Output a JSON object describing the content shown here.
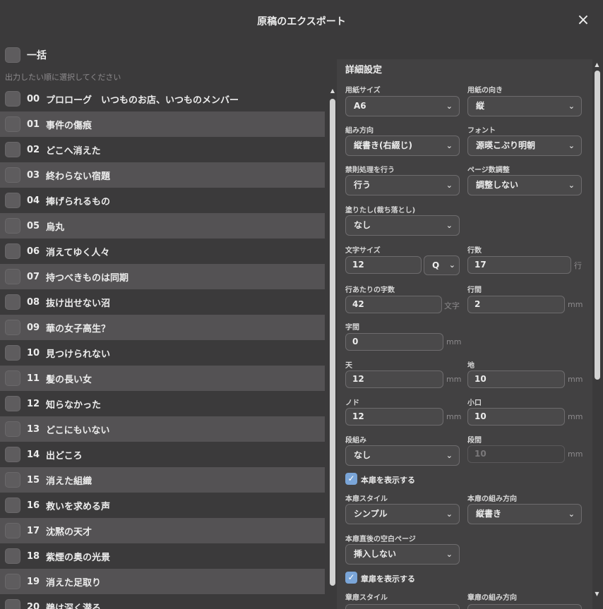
{
  "dialog": {
    "title": "原稿のエクスポート",
    "close_icon": "×"
  },
  "select_all": {
    "label": "一括"
  },
  "hint": "出力したい順に選択してください",
  "chapters": [
    {
      "num": "00",
      "title": "プロローグ　いつものお店、いつものメンバー"
    },
    {
      "num": "01",
      "title": "事件の傷痕"
    },
    {
      "num": "02",
      "title": "どこへ消えた"
    },
    {
      "num": "03",
      "title": "終わらない宿題"
    },
    {
      "num": "04",
      "title": "捧げられるもの"
    },
    {
      "num": "05",
      "title": "烏丸"
    },
    {
      "num": "06",
      "title": "消えてゆく人々"
    },
    {
      "num": "07",
      "title": "持つべきものは同期"
    },
    {
      "num": "08",
      "title": "抜け出せない沼"
    },
    {
      "num": "09",
      "title": "華の女子高生？"
    },
    {
      "num": "10",
      "title": "見つけられない"
    },
    {
      "num": "11",
      "title": "髪の長い女"
    },
    {
      "num": "12",
      "title": "知らなかった"
    },
    {
      "num": "13",
      "title": "どこにもいない"
    },
    {
      "num": "14",
      "title": "出どころ"
    },
    {
      "num": "15",
      "title": "消えた組織"
    },
    {
      "num": "16",
      "title": "救いを求める声"
    },
    {
      "num": "17",
      "title": "沈黙の天才"
    },
    {
      "num": "18",
      "title": "紫煙の奥の光景"
    },
    {
      "num": "19",
      "title": "消えた足取り"
    },
    {
      "num": "20",
      "title": "鵜は深く潜る"
    }
  ],
  "settings": {
    "title": "詳細設定",
    "paper_size": {
      "label": "用紙サイズ",
      "value": "A6"
    },
    "orientation": {
      "label": "用紙の向き",
      "value": "縦"
    },
    "writing_direction": {
      "label": "組み方向",
      "value": "縦書き(右綴じ)"
    },
    "font": {
      "label": "フォント",
      "value": "源暎こぶり明朝"
    },
    "kinsoku": {
      "label": "禁則処理を行う",
      "value": "行う"
    },
    "page_adjust": {
      "label": "ページ数調整",
      "value": "調整しない"
    },
    "bleed": {
      "label": "塗りたし(裁ち落とし)",
      "value": "なし"
    },
    "char_size": {
      "label": "文字サイズ",
      "value": "12",
      "unit_value": "Q"
    },
    "lines": {
      "label": "行数",
      "value": "17",
      "unit": "行"
    },
    "chars_per_line": {
      "label": "行あたりの字数",
      "value": "42",
      "unit": "文字"
    },
    "line_spacing": {
      "label": "行間",
      "value": "2",
      "unit": "mm"
    },
    "char_spacing": {
      "label": "字間",
      "value": "0",
      "unit": "mm"
    },
    "top": {
      "label": "天",
      "value": "12",
      "unit": "mm"
    },
    "bottom": {
      "label": "地",
      "value": "10",
      "unit": "mm"
    },
    "gutter": {
      "label": "ノド",
      "value": "12",
      "unit": "mm"
    },
    "fore_edge": {
      "label": "小口",
      "value": "10",
      "unit": "mm"
    },
    "columns": {
      "label": "段組み",
      "value": "なし"
    },
    "column_gap": {
      "label": "段間",
      "value": "10",
      "unit": "mm"
    },
    "show_title_page": {
      "label": "本扉を表示する",
      "checked": true
    },
    "title_style": {
      "label": "本扉スタイル",
      "value": "シンプル"
    },
    "title_direction": {
      "label": "本扉の組み方向",
      "value": "縦書き"
    },
    "title_blank_page": {
      "label": "本扉直後の空白ページ",
      "value": "挿入しない"
    },
    "show_chapter_page": {
      "label": "章扉を表示する",
      "checked": true
    },
    "chapter_style": {
      "label": "章扉スタイル"
    },
    "chapter_direction": {
      "label": "章扉の組み方向"
    }
  }
}
